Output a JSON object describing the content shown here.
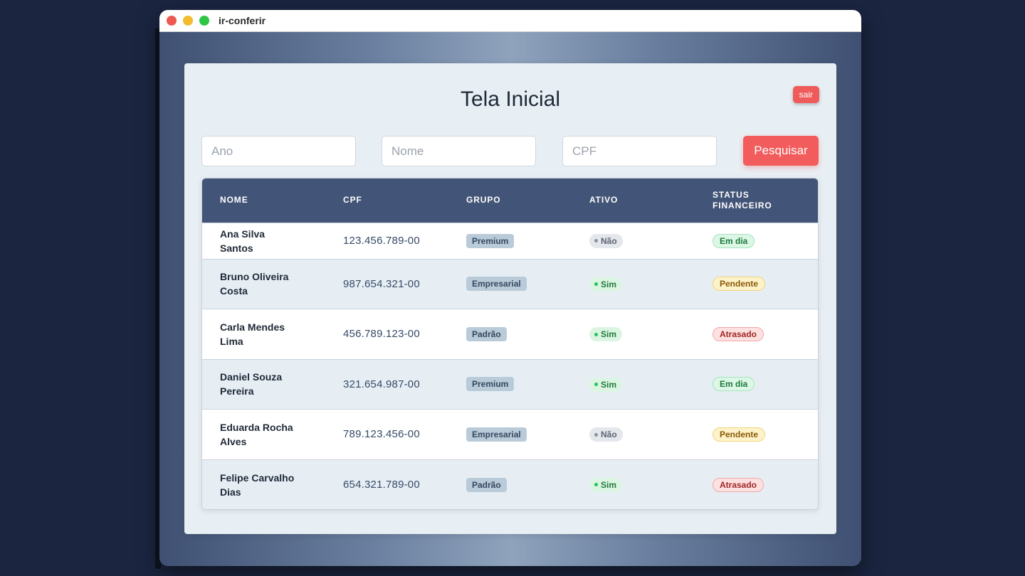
{
  "window": {
    "title": "ir-conferir"
  },
  "page": {
    "title": "Tela Inicial",
    "logout_label": "sair"
  },
  "filters": {
    "ano_placeholder": "Ano",
    "nome_placeholder": "Nome",
    "cpf_placeholder": "CPF",
    "search_label": "Pesquisar"
  },
  "table": {
    "headers": {
      "nome": "NOME",
      "cpf": "CPF",
      "grupo": "GRUPO",
      "ativo": "ATIVO",
      "status": "STATUS FINANCEIRO"
    },
    "rows": [
      {
        "nome": "Ana Silva Santos",
        "cpf": "123.456.789-00",
        "grupo": "Premium",
        "ativo": "Não",
        "status": "Em dia"
      },
      {
        "nome": "Bruno Oliveira Costa",
        "cpf": "987.654.321-00",
        "grupo": "Empresarial",
        "ativo": "Sim",
        "status": "Pendente"
      },
      {
        "nome": "Carla Mendes Lima",
        "cpf": "456.789.123-00",
        "grupo": "Padrão",
        "ativo": "Sim",
        "status": "Atrasado"
      },
      {
        "nome": "Daniel Souza Pereira",
        "cpf": "321.654.987-00",
        "grupo": "Premium",
        "ativo": "Sim",
        "status": "Em dia"
      },
      {
        "nome": "Eduarda Rocha Alves",
        "cpf": "789.123.456-00",
        "grupo": "Empresarial",
        "ativo": "Não",
        "status": "Pendente"
      },
      {
        "nome": "Felipe Carvalho Dias",
        "cpf": "654.321.789-00",
        "grupo": "Padrão",
        "ativo": "Sim",
        "status": "Atrasado"
      }
    ]
  },
  "colors": {
    "accent_red": "#f25c5c",
    "table_header": "#425477",
    "active_yes": "#22c55e",
    "active_no": "#8b929c"
  }
}
